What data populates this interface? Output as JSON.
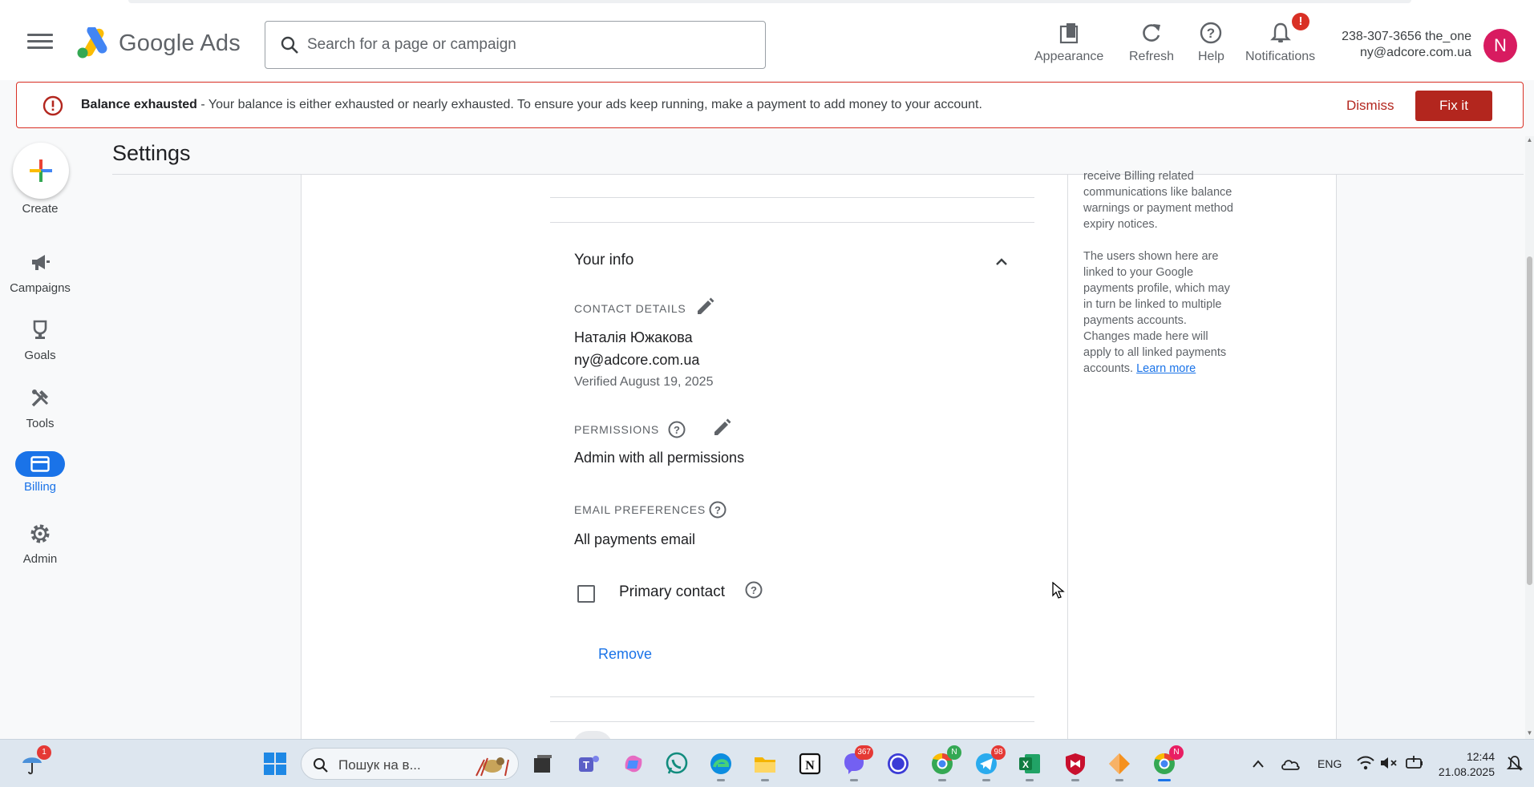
{
  "header": {
    "brand": "Google Ads",
    "search_placeholder": "Search for a page or campaign",
    "tools": [
      {
        "label": "Appearance",
        "icon": "appearance-icon"
      },
      {
        "label": "Refresh",
        "icon": "refresh-icon"
      },
      {
        "label": "Help",
        "icon": "help-icon"
      },
      {
        "label": "Notifications",
        "icon": "bell-icon",
        "badge": "!"
      }
    ],
    "account": {
      "line1": "238-307-3656 the_one",
      "line2": "ny@adcore.com.ua",
      "avatar_letter": "N"
    }
  },
  "banner": {
    "title": "Balance exhausted",
    "message": " - Your balance is either exhausted or nearly exhausted. To ensure your ads keep running, make a payment to add money to your account.",
    "dismiss_label": "Dismiss",
    "fix_label": "Fix it"
  },
  "nav": {
    "create_label": "Create",
    "items": [
      {
        "label": "Campaigns",
        "icon": "megaphone-icon"
      },
      {
        "label": "Goals",
        "icon": "trophy-icon"
      },
      {
        "label": "Tools",
        "icon": "tools-icon"
      },
      {
        "label": "Billing",
        "icon": "billing-card-icon",
        "active": true
      },
      {
        "label": "Admin",
        "icon": "gear-icon"
      }
    ]
  },
  "page": {
    "title": "Settings"
  },
  "your_info": {
    "title": "Your info",
    "contact": {
      "label": "CONTACT DETAILS",
      "name": "Наталія Южакова",
      "email": "ny@adcore.com.ua",
      "verified": "Verified August 19, 2025"
    },
    "permissions": {
      "label": "PERMISSIONS",
      "value": "Admin with all permissions"
    },
    "email_prefs": {
      "label": "EMAIL PREFERENCES",
      "value": "All payments email"
    },
    "primary_contact_label": "Primary contact",
    "primary_contact_checked": false,
    "remove_label": "Remove"
  },
  "side_panel": {
    "para1_partial": "receive Billing related communications like balance warnings or payment method expiry notices.",
    "para2": "The users shown here are linked to your Google payments profile, which may in turn be linked to multiple payments accounts. Changes made here will apply to all linked payments accounts. ",
    "learn_more": "Learn more"
  },
  "taskbar": {
    "search_placeholder": "Пошук на в...",
    "lang": "ENG",
    "time": "12:44",
    "date": "21.08.2025",
    "badges": {
      "weather": "1",
      "viber": "367",
      "telegram": "98",
      "chrome_profile": "N",
      "chrome_active": "N"
    }
  },
  "colors": {
    "accent_blue": "#1a73e8",
    "alert_red": "#b3261e",
    "avatar_pink": "#d81b60"
  }
}
